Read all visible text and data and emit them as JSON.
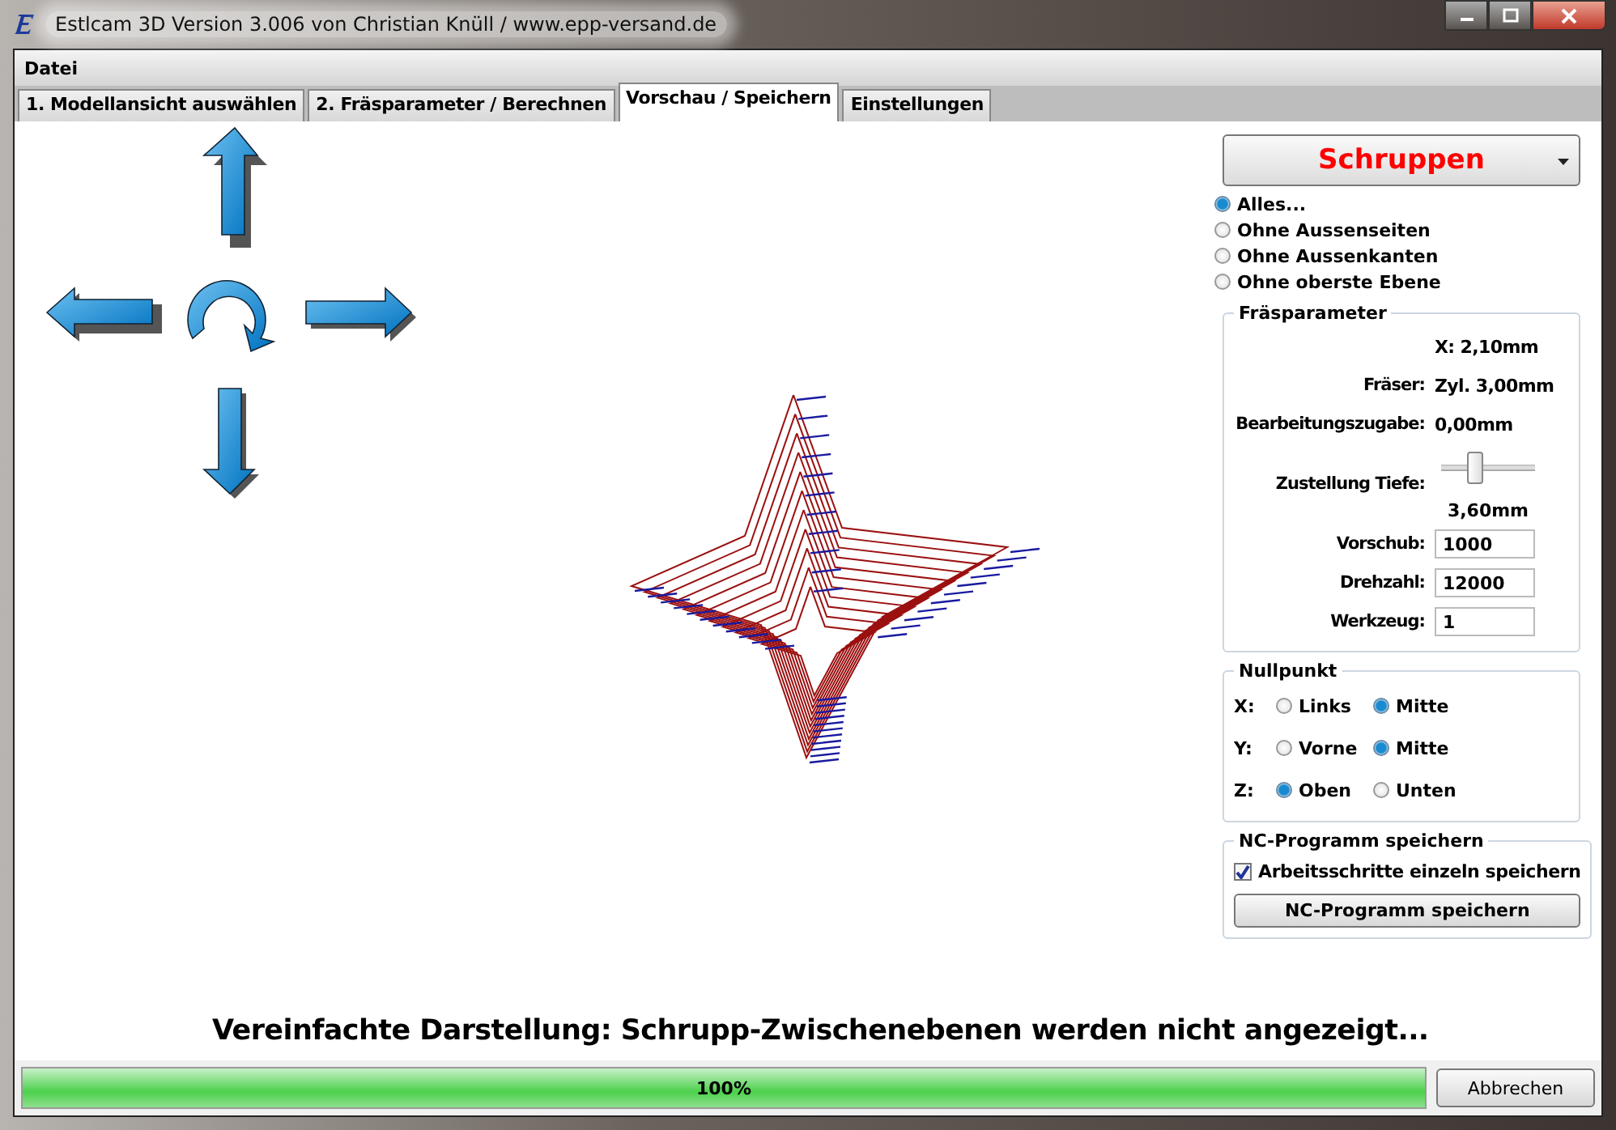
{
  "window": {
    "title": "Estlcam 3D Version 3.006 von Christian Knüll / www.epp-versand.de"
  },
  "menu": [
    "Datei"
  ],
  "tabs": [
    {
      "label": "1. Modellansicht auswählen",
      "selected": false
    },
    {
      "label": "2. Fräsparameter / Berechnen",
      "selected": false
    },
    {
      "label": "Vorschau / Speichern",
      "selected": true
    },
    {
      "label": "Einstellungen",
      "selected": false
    }
  ],
  "strategy": {
    "label": "Schruppen"
  },
  "options": [
    {
      "label": "Alles...",
      "selected": true
    },
    {
      "label": "Ohne Aussenseiten",
      "selected": false
    },
    {
      "label": "Ohne Aussenkanten",
      "selected": false
    },
    {
      "label": "Ohne oberste Ebene",
      "selected": false
    }
  ],
  "params": {
    "title": "Fräsparameter",
    "rows": [
      {
        "kind": "note",
        "value": "X: 2,10mm"
      },
      {
        "kind": "text",
        "label": "Fräser:",
        "value": "Zyl. 3,00mm"
      },
      {
        "kind": "text",
        "label": "Bearbeitungszugabe:",
        "value": "0,00mm"
      },
      {
        "kind": "slider",
        "label": "Zustellung Tiefe:",
        "level": 0.35,
        "value": "3,60mm"
      },
      {
        "kind": "input",
        "label": "Vorschub:",
        "value": "1000"
      },
      {
        "kind": "input",
        "label": "Drehzahl:",
        "value": "12000"
      },
      {
        "kind": "input",
        "label": "Werkzeug:",
        "value": "1"
      }
    ]
  },
  "zero": {
    "title": "Nullpunkt",
    "axes": [
      {
        "label": "X:",
        "options": [
          {
            "label": "Links",
            "selected": false
          },
          {
            "label": "Mitte",
            "selected": true
          }
        ]
      },
      {
        "label": "Y:",
        "options": [
          {
            "label": "Vorne",
            "selected": false
          },
          {
            "label": "Mitte",
            "selected": true
          }
        ]
      },
      {
        "label": "Z:",
        "options": [
          {
            "label": "Oben",
            "selected": true
          },
          {
            "label": "Unten",
            "selected": false
          }
        ]
      }
    ]
  },
  "save": {
    "title": "NC-Programm speichern",
    "checkbox": {
      "label": "Arbeitsschritte einzeln speichern",
      "checked": true
    },
    "button": "NC-Programm speichern"
  },
  "message": "Vereinfachte Darstellung: Schrupp-Zwischenebenen werden nicht angezeigt...",
  "progress": {
    "level": 1,
    "text": "100%"
  },
  "cancel": "Abbrechen"
}
